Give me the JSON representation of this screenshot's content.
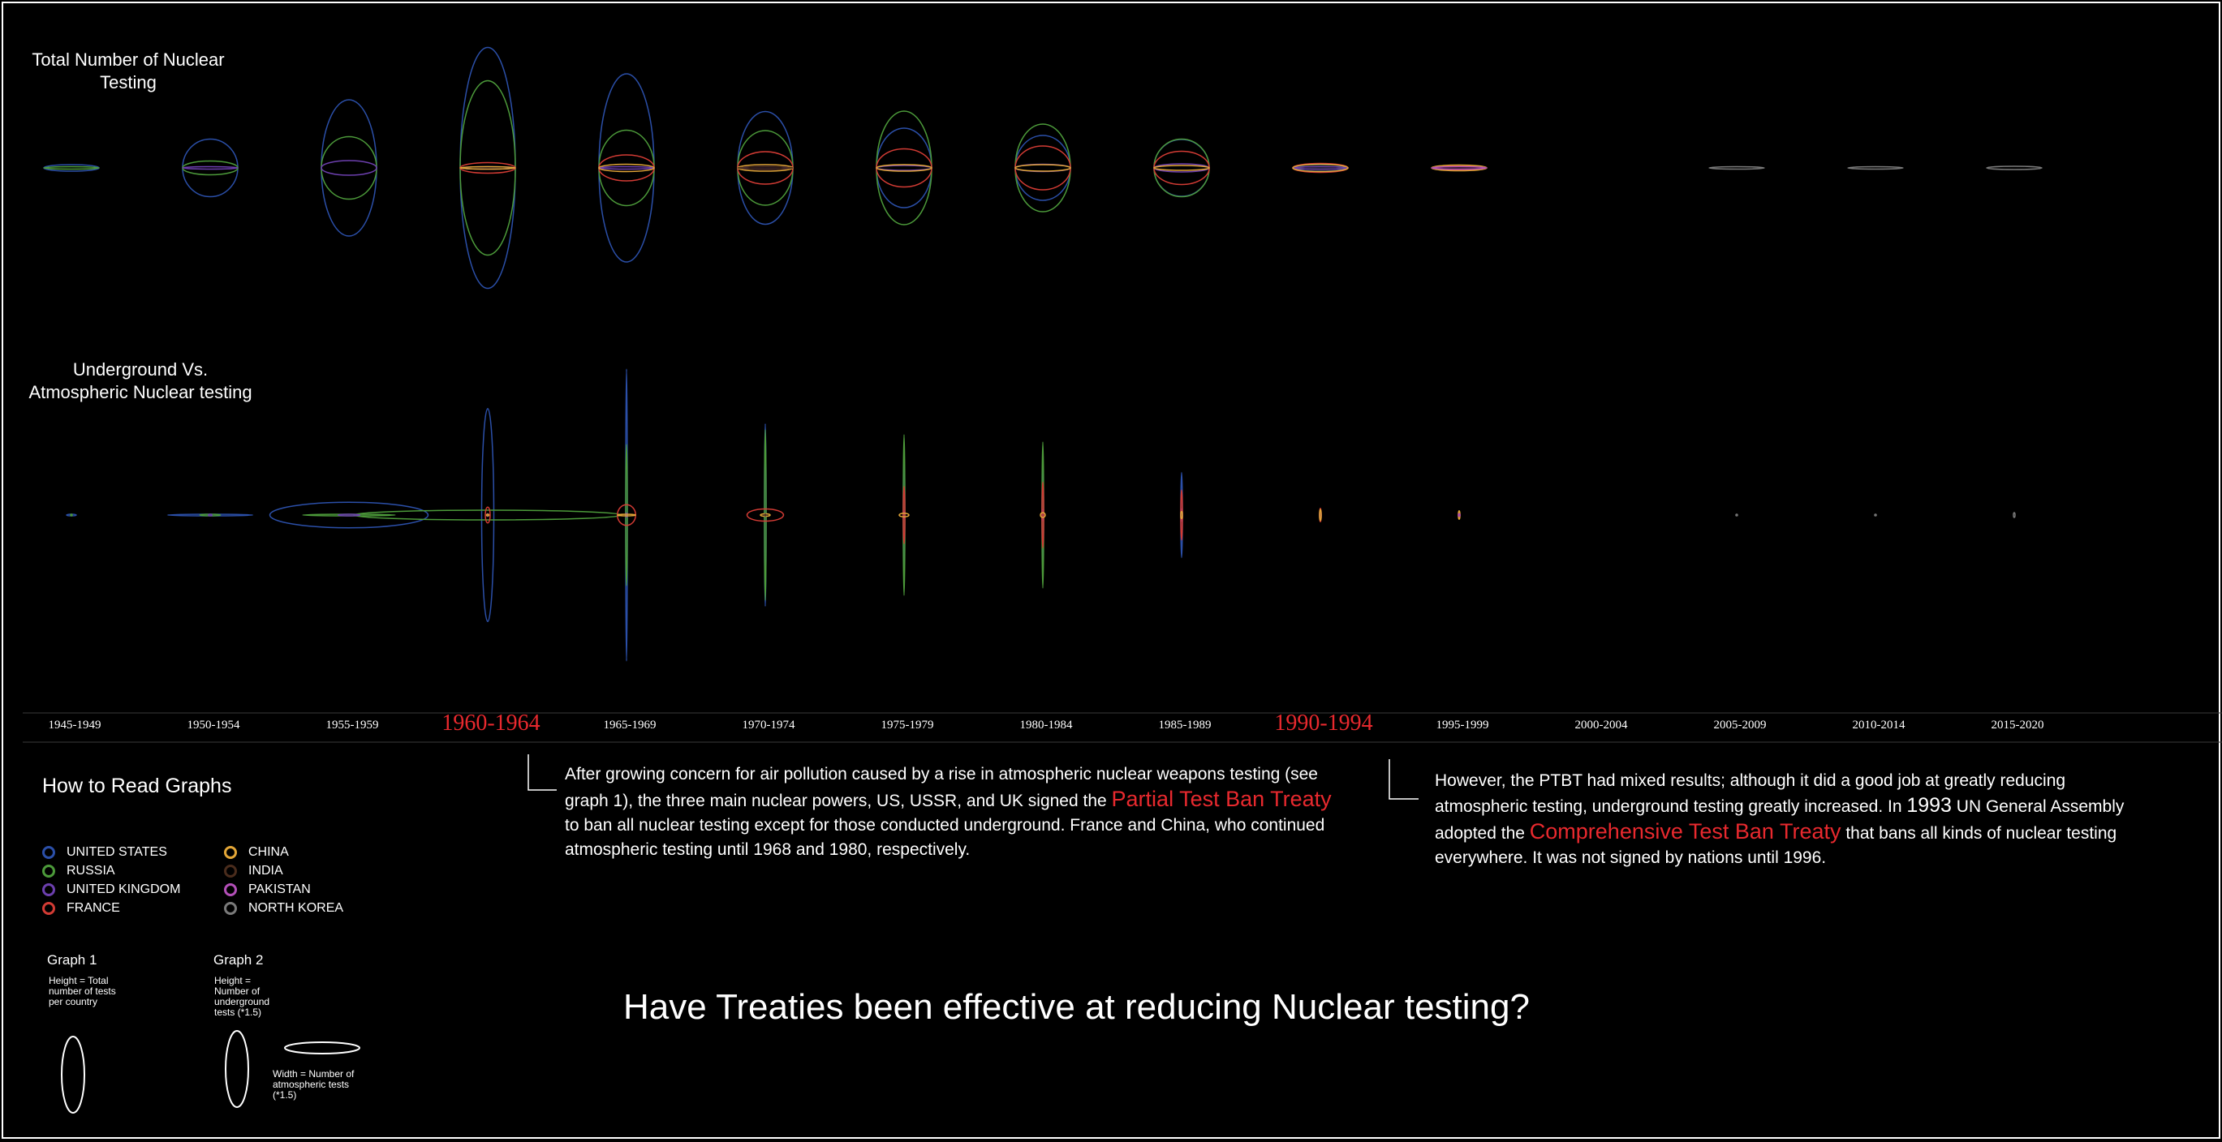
{
  "titles": {
    "graph1": "Total Number of Nuclear Testing",
    "graph2": "Underground Vs. Atmospheric Nuclear testing",
    "question": "Have Treaties been effective at reducing Nuclear testing?"
  },
  "colors": {
    "background": "#000000",
    "highlight": "#e8292e",
    "UNITED STATES": "#2b4fa8",
    "RUSSIA": "#4c9a3a",
    "UNITED KINGDOM": "#6c3fae",
    "FRANCE": "#d23b34",
    "CHINA": "#e3a637",
    "INDIA": "#4a2c1c",
    "PAKISTAN": "#b34fb8",
    "NORTH KOREA": "#7a7a7a"
  },
  "chart_data": [
    {
      "type": "scatter",
      "title": "Total Number of Nuclear Testing",
      "encoding": "ellipse height = total number of tests per country",
      "categories": [
        "1945-1949",
        "1950-1954",
        "1955-1959",
        "1960-1964",
        "1965-1969",
        "1970-1974",
        "1975-1979",
        "1980-1984",
        "1985-1989",
        "1990-1994",
        "1995-1999",
        "2000-2004",
        "2005-2009",
        "2010-2014",
        "2015-2020"
      ],
      "series": [
        {
          "name": "UNITED STATES",
          "values": [
            8,
            71,
            168,
            297,
            232,
            139,
            98,
            80,
            70,
            8,
            0,
            0,
            0,
            0,
            0
          ]
        },
        {
          "name": "RUSSIA",
          "values": [
            1,
            17,
            77,
            215,
            93,
            92,
            140,
            108,
            71,
            1,
            0,
            0,
            0,
            0,
            0
          ]
        },
        {
          "name": "UNITED KINGDOM",
          "values": [
            0,
            3,
            18,
            2,
            3,
            1,
            6,
            9,
            10,
            2,
            0,
            0,
            0,
            0,
            0
          ]
        },
        {
          "name": "FRANCE",
          "values": [
            0,
            0,
            0,
            13,
            32,
            40,
            47,
            54,
            41,
            11,
            5,
            0,
            0,
            0,
            0
          ]
        },
        {
          "name": "CHINA",
          "values": [
            0,
            0,
            0,
            2,
            9,
            8,
            8,
            8,
            6,
            9,
            7,
            0,
            0,
            0,
            0
          ]
        },
        {
          "name": "INDIA",
          "values": [
            0,
            0,
            0,
            0,
            0,
            1,
            0,
            0,
            0,
            0,
            2,
            0,
            0,
            0,
            0
          ]
        },
        {
          "name": "PAKISTAN",
          "values": [
            0,
            0,
            0,
            0,
            0,
            0,
            0,
            0,
            0,
            0,
            2,
            0,
            0,
            0,
            0
          ]
        },
        {
          "name": "NORTH KOREA",
          "values": [
            0,
            0,
            0,
            0,
            0,
            0,
            0,
            0,
            0,
            0,
            0,
            0,
            1,
            1,
            4
          ]
        }
      ]
    },
    {
      "type": "scatter",
      "title": "Underground Vs. Atmospheric Nuclear testing",
      "encoding": "ellipse height = number of underground tests (*1.5); width = number of atmospheric tests (*1.5)",
      "categories": [
        "1945-1949",
        "1950-1954",
        "1955-1959",
        "1960-1964",
        "1965-1969",
        "1970-1974",
        "1975-1979",
        "1980-1984",
        "1985-1989",
        "1990-1994",
        "1995-1999",
        "2000-2004",
        "2005-2009",
        "2010-2014",
        "2015-2020"
      ],
      "series": [
        {
          "name": "UNITED STATES",
          "underground": [
            0,
            1,
            21,
            175,
            240,
            150,
            98,
            80,
            70,
            8,
            0,
            0,
            0,
            0,
            0
          ],
          "atmospheric": [
            8,
            70,
            130,
            10,
            0,
            0,
            0,
            0,
            0,
            0,
            0,
            0,
            0,
            0,
            0
          ]
        },
        {
          "name": "RUSSIA",
          "underground": [
            0,
            0,
            0,
            8,
            116,
            140,
            132,
            120,
            0,
            0,
            0,
            0,
            0,
            0,
            0
          ],
          "atmospheric": [
            1,
            17,
            76,
            220,
            0,
            0,
            0,
            0,
            0,
            0,
            0,
            0,
            0,
            0,
            0
          ]
        },
        {
          "name": "UNITED KINGDOM",
          "underground": [
            0,
            0,
            0,
            2,
            3,
            1,
            6,
            9,
            10,
            2,
            0,
            0,
            0,
            0,
            0
          ],
          "atmospheric": [
            0,
            3,
            18,
            0,
            0,
            0,
            0,
            0,
            0,
            0,
            0,
            0,
            0,
            0,
            0
          ]
        },
        {
          "name": "FRANCE",
          "underground": [
            0,
            0,
            0,
            13,
            17,
            10,
            47,
            54,
            41,
            11,
            5,
            0,
            0,
            0,
            0
          ],
          "atmospheric": [
            0,
            0,
            0,
            4,
            15,
            30,
            0,
            0,
            0,
            0,
            0,
            0,
            0,
            0,
            0
          ]
        },
        {
          "name": "CHINA",
          "underground": [
            0,
            0,
            0,
            0,
            1,
            2,
            3,
            4,
            6,
            9,
            7,
            0,
            0,
            0,
            0
          ],
          "atmospheric": [
            0,
            0,
            0,
            2,
            15,
            8,
            8,
            4,
            0,
            0,
            0,
            0,
            0,
            0,
            0
          ]
        },
        {
          "name": "INDIA",
          "underground": [
            0,
            0,
            0,
            0,
            0,
            1,
            0,
            0,
            0,
            0,
            2,
            0,
            0,
            0,
            0
          ],
          "atmospheric": [
            0,
            0,
            0,
            0,
            0,
            0,
            0,
            0,
            0,
            0,
            0,
            0,
            0,
            0,
            0
          ]
        },
        {
          "name": "PAKISTAN",
          "underground": [
            0,
            0,
            0,
            0,
            0,
            0,
            0,
            0,
            0,
            0,
            2,
            0,
            0,
            0,
            0
          ],
          "atmospheric": [
            0,
            0,
            0,
            0,
            0,
            0,
            0,
            0,
            0,
            0,
            0,
            0,
            0,
            0,
            0
          ]
        },
        {
          "name": "NORTH KOREA",
          "underground": [
            0,
            0,
            0,
            0,
            0,
            0,
            0,
            0,
            0,
            0,
            0,
            0,
            1,
            1,
            4
          ],
          "atmospheric": [
            0,
            0,
            0,
            0,
            0,
            0,
            0,
            0,
            0,
            0,
            0,
            0,
            0,
            0,
            0
          ]
        }
      ]
    }
  ],
  "periods": [
    "1945-1949",
    "1950-1954",
    "1955-1959",
    "1960-1964",
    "1965-1969",
    "1970-1974",
    "1975-1979",
    "1980-1984",
    "1985-1989",
    "1990-1994",
    "1995-1999",
    "2000-2004",
    "2005-2009",
    "2010-2014",
    "2015-2020"
  ],
  "highlighted_periods": [
    "1960-1964",
    "1990-1994"
  ],
  "annotation1": {
    "text_a": "After growing concern for air pollution caused by a rise in atmospheric nuclear weapons testing (see graph 1), the three main nuclear powers, US, USSR, and UK signed the ",
    "treaty": "Partial Test Ban Treaty",
    "text_b": " to ban all nuclear testing except for those conducted underground. France and China, who continued atmospheric testing until 1968 and 1980, respectively."
  },
  "annotation2": {
    "text_a": "However, the PTBT had mixed results; although it did a good job at greatly reducing atmospheric testing, underground testing greatly increased. In ",
    "year": "1993",
    "text_b": " UN General Assembly adopted the ",
    "treaty": "Comprehensive Test Ban Treaty",
    "text_c": " that bans all kinds of nuclear testing everywhere. It was not signed by nations until 1996."
  },
  "legend": {
    "title": "How to Read Graphs",
    "countries_col1": [
      "UNITED STATES",
      "RUSSIA",
      "UNITED KINGDOM",
      "FRANCE"
    ],
    "countries_col2": [
      "CHINA",
      "INDIA",
      "PAKISTAN",
      "NORTH KOREA"
    ],
    "graph1_title": "Graph 1",
    "graph1_desc": "Height = Total number of tests per country",
    "graph2_title": "Graph 2",
    "graph2_height_desc": "Height = Number of underground tests (*1.5)",
    "graph2_width_desc": "Width = Number of atmospheric tests (*1.5)"
  }
}
